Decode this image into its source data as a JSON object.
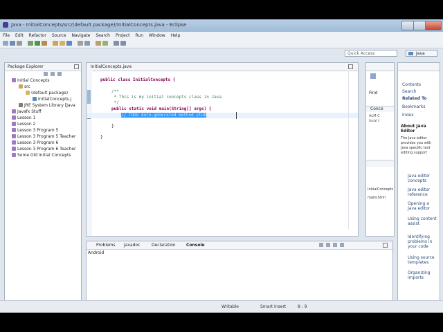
{
  "window": {
    "title": "Java - InitialConcepts/src/(default package)/InitialConcepts.java - Eclipse"
  },
  "menu": [
    "File",
    "Edit",
    "Refactor",
    "Source",
    "Navigate",
    "Search",
    "Project",
    "Run",
    "Window",
    "Help"
  ],
  "quick_access": {
    "placeholder": "Quick Access"
  },
  "perspective": {
    "label": "Java"
  },
  "package_explorer": {
    "title": "Package Explorer",
    "items": [
      {
        "label": "Initial Concepts",
        "indent": 0
      },
      {
        "label": "src",
        "indent": 1
      },
      {
        "label": "(default package)",
        "indent": 2
      },
      {
        "label": "InitialConcepts.j",
        "indent": 3
      },
      {
        "label": "JRE System Library [Java",
        "indent": 1
      },
      {
        "label": "Javafx Stuff",
        "indent": 0
      },
      {
        "label": "Lesson 1",
        "indent": 0
      },
      {
        "label": "Lesson 2",
        "indent": 0
      },
      {
        "label": "Lesson 3 Program 5",
        "indent": 0
      },
      {
        "label": "Lesson 3 Program 5 Teacher",
        "indent": 0
      },
      {
        "label": "Lesson 3 Program 6",
        "indent": 0
      },
      {
        "label": "Lesson 3 Program 6 Teacher",
        "indent": 0
      },
      {
        "label": "Some Old Initial Concepts",
        "indent": 0
      }
    ]
  },
  "editor": {
    "tab": "InitialConcepts.java",
    "lines": {
      "l1": "public class InitialConcepts {",
      "l2": "/**",
      "l3": " * This is my initial concepts class in Java",
      "l4": " */",
      "l5": "public static void main(String[] args) {",
      "l6": "// TODO Auto-generated method stub",
      "l7": "}",
      "l8": "}"
    }
  },
  "bottom_panel": {
    "tabs": [
      "Problems",
      "Javadoc",
      "Declaration",
      "Console"
    ],
    "active_tab": "Console",
    "content": "Android"
  },
  "right_views": {
    "find": "Find",
    "outline_label": "Conce",
    "outline_text": [
      "ALM C",
      "local t"
    ],
    "outline_items": [
      "InitialConcepts",
      "main(Strin"
    ],
    "help": {
      "items": [
        "Contents",
        "Search",
        "Related To",
        "Bookmarks",
        "Index"
      ],
      "about_title": "About Java Editor",
      "about_text": "The Java editor provides you with Java specific text editing support",
      "links": [
        "Java editor concepts",
        "Java editor reference",
        "Opening a Java editor",
        "Using content assist",
        "Identifying problems in your code",
        "Using source templates",
        "Organizing imports"
      ]
    }
  },
  "status": {
    "writable": "Writable",
    "insert": "Smart Insert",
    "position": "8 : 9"
  },
  "colors": {
    "selection": "#3399ff",
    "keyword": "#7f0055",
    "comment": "#3f7f5f",
    "link": "#2a4a78"
  }
}
